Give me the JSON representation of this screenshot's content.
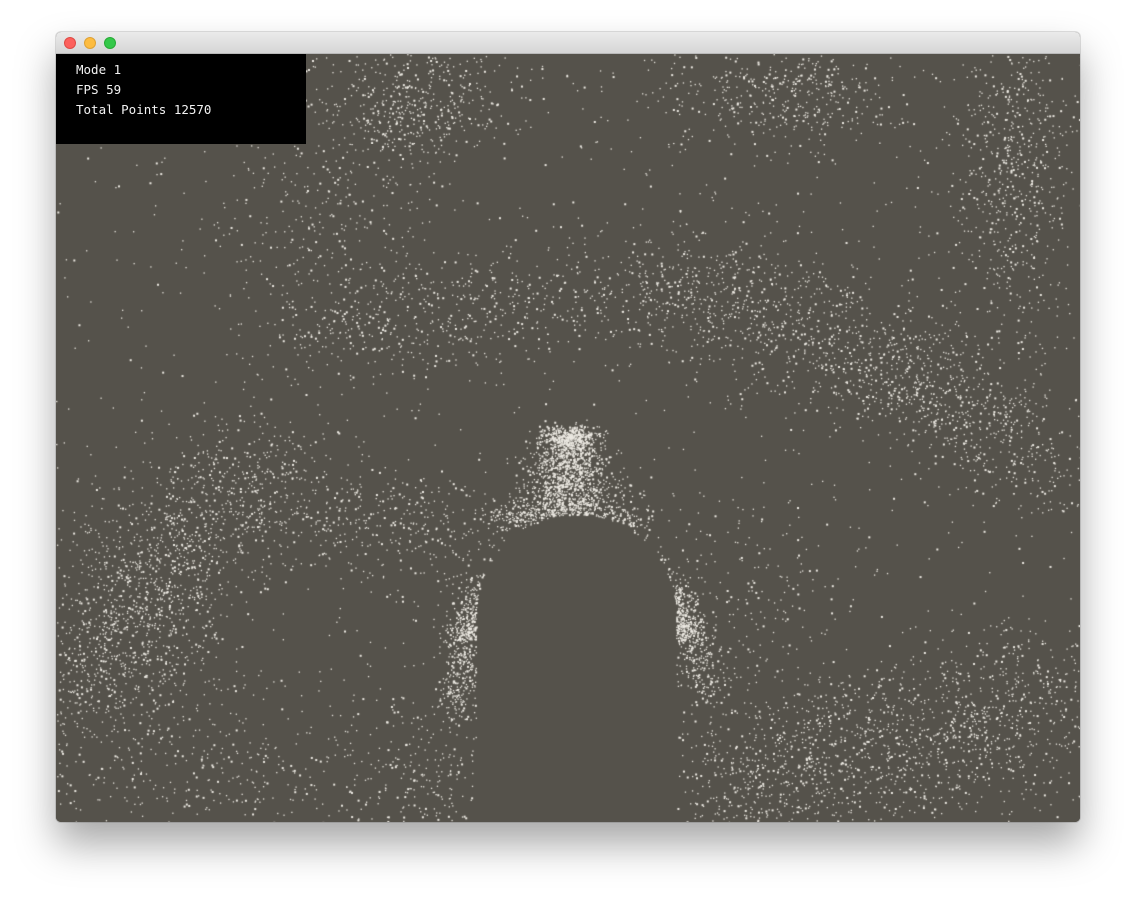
{
  "window": {
    "controls": [
      "close",
      "minimize",
      "zoom"
    ]
  },
  "hud": {
    "mode": "Mode 1",
    "fps": "FPS 59",
    "total_points": "Total Points 12570"
  },
  "colors": {
    "background": "#55524b",
    "particle": "#ece9e2",
    "hud_background": "#000000",
    "hud_text": "#f2f2f2"
  }
}
